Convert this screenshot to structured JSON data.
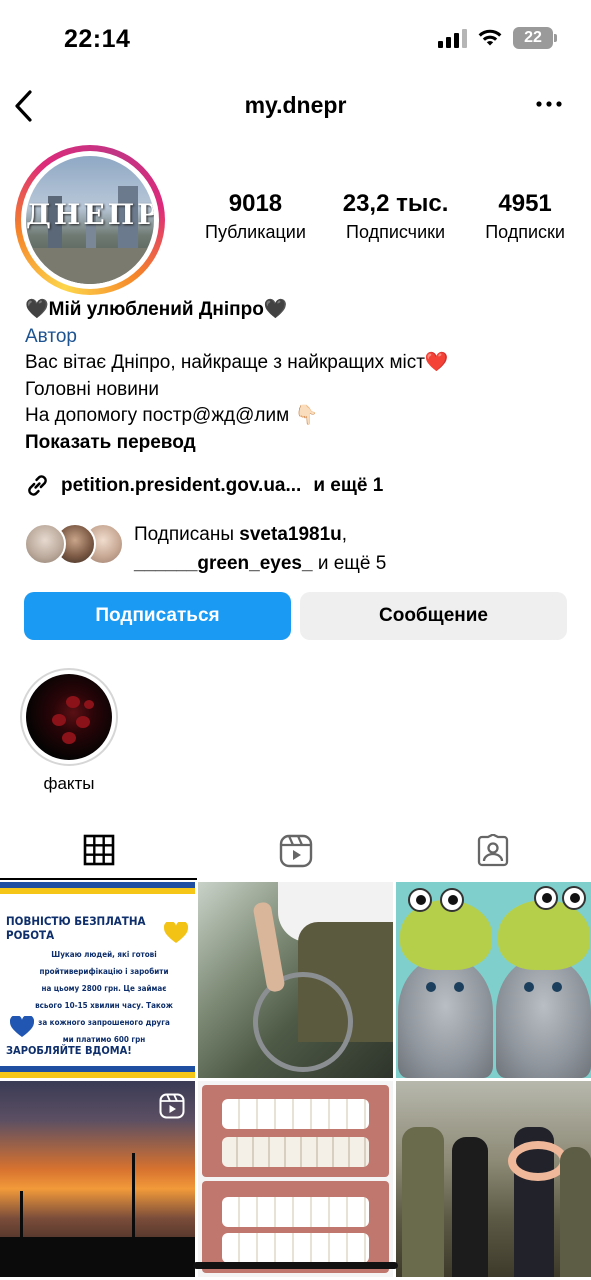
{
  "status": {
    "time": "22:14",
    "battery": "22"
  },
  "header": {
    "username": "my.dnepr",
    "back_icon": "chevron-left-icon",
    "more_icon": "ellipsis-icon"
  },
  "avatar": {
    "city_text": "ДНЕПР"
  },
  "stats": [
    {
      "value": "9018",
      "label": "Публикации"
    },
    {
      "value": "23,2 тыс.",
      "label": "Подписчики"
    },
    {
      "value": "4951",
      "label": "Подписки"
    }
  ],
  "bio": {
    "name": "🖤Мій улюблений Дніпро🖤",
    "category": "Автор",
    "line1": "Вас вітає Дніпро, найкраще з найкращих міст❤️",
    "line2": "Головні новини",
    "line3": "На допомогу постр@жд@лим 👇🏻",
    "translate": "Показать перевод"
  },
  "link": {
    "url": "petition.president.gov.ua...",
    "more": "и ещё 1"
  },
  "followed_by": {
    "prefix": "Подписаны ",
    "user1": "sveta1981u",
    "sep": ",",
    "user2": "______green_eyes_",
    "suffix": " и ещё 5"
  },
  "buttons": {
    "follow": "Подписаться",
    "message": "Сообщение"
  },
  "highlights": [
    {
      "label": "факты"
    }
  ],
  "tabs": [
    {
      "name": "grid-icon",
      "active": true
    },
    {
      "name": "reels-icon"
    },
    {
      "name": "tagged-icon"
    }
  ],
  "posts": {
    "ad": {
      "title": "ПОВНІСТЮ БЕЗПЛАТНА РОБОТА",
      "body": "Шукаю людей, які готові пройтиверифікацію і заробити на цьому 2800 грн. Це займає всього 10-15 хвилин часу. Також за кожного запрошеного друга ми платимо 600 грн",
      "footer": "ЗАРОБЛЯЙТЕ ВДОМА!"
    }
  },
  "colors": {
    "accent": "#1a9af2",
    "link_category": "#1d5391"
  }
}
